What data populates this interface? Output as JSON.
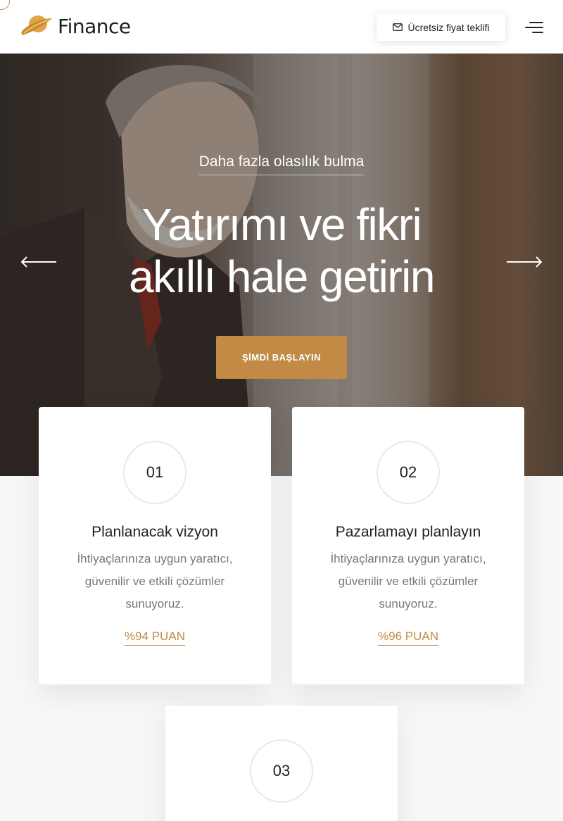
{
  "header": {
    "brand": "Finance",
    "quote_label": "Ücretsiz fiyat teklifi",
    "icons": {
      "logo": "planet-logo-icon",
      "mail": "mail-icon",
      "menu": "hamburger-menu-icon"
    }
  },
  "hero": {
    "subtitle": "Daha fazla olasılık bulma",
    "title_line1": "Yatırımı ve fikri",
    "title_line2": "akıllı hale getirin",
    "cta_label": "ŞİMDİ BAŞLAYIN",
    "icons": {
      "prev": "arrow-left-icon",
      "next": "arrow-right-icon"
    }
  },
  "features": [
    {
      "number": "01",
      "title": "Planlanacak vizyon",
      "description": "İhtiyaçlarınıza uygun yaratıcı, güvenilir ve etkili çözümler sunuyoruz.",
      "score": "%94 PUAN"
    },
    {
      "number": "02",
      "title": "Pazarlamayı planlayın",
      "description": "İhtiyaçlarınıza uygun yaratıcı, güvenilir ve etkili çözümler sunuyoruz.",
      "score": "%96 PUAN"
    },
    {
      "number": "03"
    }
  ],
  "colors": {
    "accent": "#c18b45",
    "text": "#222222",
    "muted": "#777777",
    "background": "#f7f7f7"
  }
}
